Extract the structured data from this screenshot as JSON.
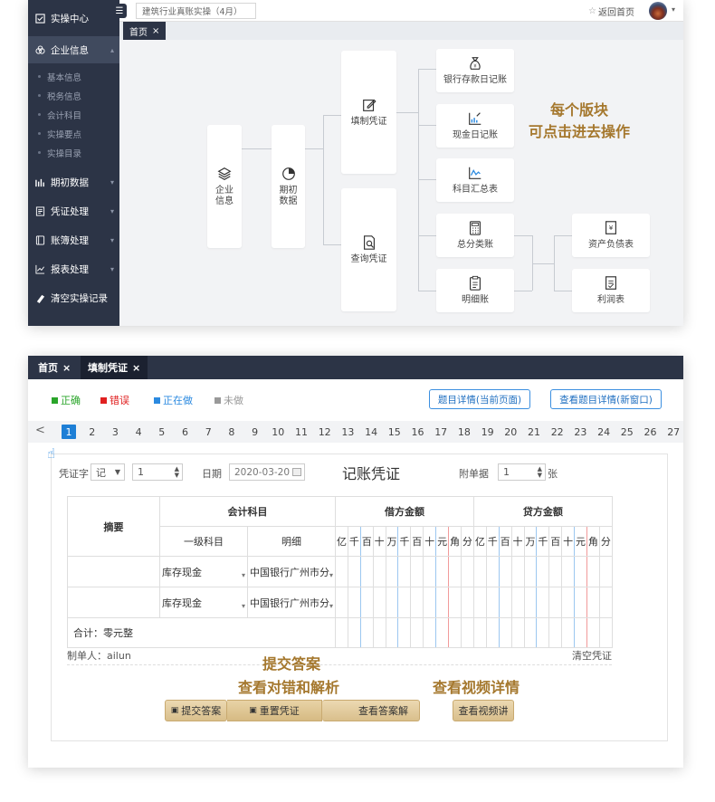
{
  "sidebar": {
    "items": [
      {
        "icon": "check-square-icon",
        "label": "实操中心"
      },
      {
        "icon": "building-icon",
        "label": "企业信息"
      },
      {
        "icon": "bar-chart-icon",
        "label": "期初数据"
      },
      {
        "icon": "document-icon",
        "label": "凭证处理"
      },
      {
        "icon": "ledger-icon",
        "label": "账簿处理"
      },
      {
        "icon": "line-chart-icon",
        "label": "报表处理"
      },
      {
        "icon": "eraser-icon",
        "label": "清空实操记录"
      }
    ],
    "subitems": [
      "基本信息",
      "税务信息",
      "会计科目",
      "实操要点",
      "实操目录"
    ]
  },
  "topbar": {
    "search_value": "建筑行业真账实操（4月）",
    "home_link": "返回首页"
  },
  "tabs_top": {
    "home": "首页",
    "close": "×"
  },
  "flow": {
    "enterprise": "企业\n信息",
    "opening": "期初\n数据",
    "fill_voucher": "填制凭证",
    "query_voucher": "查询凭证",
    "bank_journal": "银行存款日记账",
    "cash_journal": "现金日记账",
    "subject_summary": "科目汇总表",
    "general_ledger": "总分类账",
    "detail_ledger": "明细账",
    "balance_sheet": "资产负债表",
    "income_statement": "利润表",
    "annotation": "每个版块\n可点击进去操作"
  },
  "tabs_bottom": {
    "home": "首页",
    "voucher": "填制凭证",
    "close": "×"
  },
  "legend": [
    {
      "label": "正确",
      "color": "#2aa52a"
    },
    {
      "label": "错误",
      "color": "#e02020"
    },
    {
      "label": "正在做",
      "color": "#2b8ae0"
    },
    {
      "label": "未做",
      "color": "#999999"
    }
  ],
  "buttons": {
    "detail_current": "题目详情(当前页面)",
    "detail_new": "查看题目详情(新窗口)"
  },
  "pagination": {
    "prev": "<",
    "current": 1,
    "pages": [
      "1",
      "2",
      "3",
      "4",
      "5",
      "6",
      "7",
      "8",
      "9",
      "10",
      "11",
      "12",
      "13",
      "14",
      "15",
      "16",
      "17",
      "18",
      "19",
      "20",
      "21",
      "22",
      "23",
      "24",
      "25",
      "26",
      "27"
    ]
  },
  "voucher": {
    "type_label": "凭证字",
    "type_value": "记",
    "number": "1",
    "date_label": "日期",
    "date_value": "2020-03-20",
    "title": "记账凭证",
    "attach_label": "附单据",
    "attach_value": "1",
    "attach_unit": "张",
    "col_summary": "摘要",
    "col_subject": "会计科目",
    "col_level1": "一级科目",
    "col_detail": "明细",
    "col_debit": "借方金额",
    "col_credit": "贷方金额",
    "digits": [
      "亿",
      "千",
      "百",
      "十",
      "万",
      "千",
      "百",
      "十",
      "元",
      "角",
      "分"
    ],
    "rows": [
      {
        "level1": "库存现金",
        "detail": "中国银行广州市分"
      },
      {
        "level1": "库存现金",
        "detail": "中国银行广州市分"
      }
    ],
    "total": "合计：零元整",
    "maker": "制单人：ailun",
    "clear": "清空凭证"
  },
  "actions": {
    "submit": "提交答案",
    "reset": "重置凭证",
    "view_answer": "查看答案解",
    "video": "查看视频讲"
  },
  "annotations": {
    "submit": "提交答案",
    "analysis": "查看对错和解析",
    "video": "查看视频详情"
  }
}
